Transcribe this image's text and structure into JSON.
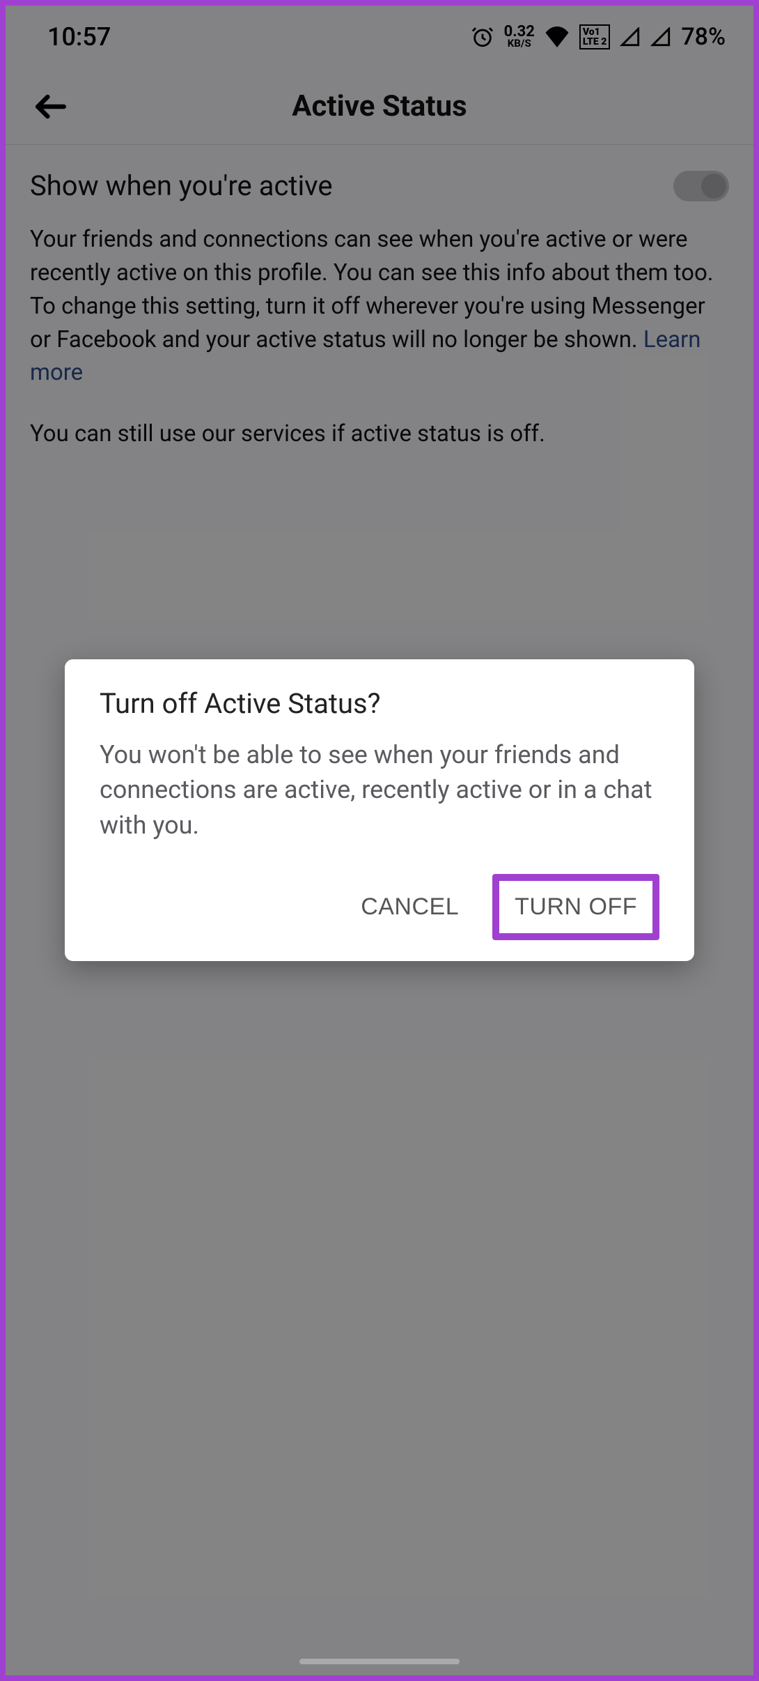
{
  "status_bar": {
    "time": "10:57",
    "data_rate_value": "0.32",
    "data_rate_unit": "KB/S",
    "lte_top": "Vo1",
    "lte_bot": "LTE 2",
    "battery": "78%"
  },
  "app_bar": {
    "title": "Active Status"
  },
  "setting": {
    "label": "Show when you're active",
    "toggle_on": false
  },
  "description_1": "Your friends and connections can see when you're active or were recently active on this profile. You can see this info about them too. To change this setting, turn it off wherever you're using Messenger or Facebook and your active status will no longer be shown. ",
  "learn_more": "Learn more",
  "description_2": "You can still use our services if active status is off.",
  "dialog": {
    "title": "Turn off Active Status?",
    "body": "You won't be able to see when your friends and connections are active, recently active or in a chat with you.",
    "cancel": "CANCEL",
    "confirm": "TURN OFF"
  }
}
